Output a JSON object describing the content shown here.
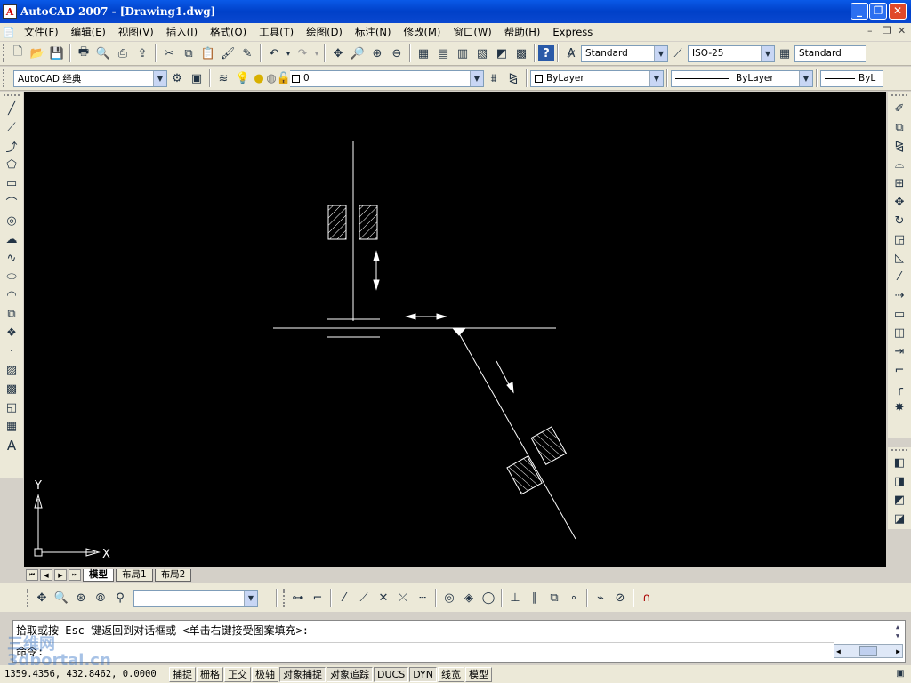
{
  "window": {
    "title": "AutoCAD 2007 - [Drawing1.dwg]",
    "app_icon": "A"
  },
  "menu": [
    "文件(F)",
    "编辑(E)",
    "视图(V)",
    "插入(I)",
    "格式(O)",
    "工具(T)",
    "绘图(D)",
    "标注(N)",
    "修改(M)",
    "窗口(W)",
    "帮助(H)",
    "Express"
  ],
  "styles": {
    "text_style": "Standard",
    "dim_style": "ISO-25",
    "table_style": "Standard"
  },
  "workspace": "AutoCAD 经典",
  "layer": {
    "current": "0"
  },
  "properties": {
    "color": "ByLayer",
    "linetype": "ByLayer",
    "lineweight": "ByL"
  },
  "ucs": {
    "x_label": "X",
    "y_label": "Y"
  },
  "layout_tabs": [
    "模型",
    "布局1",
    "布局2"
  ],
  "command": {
    "history": "拾取或按 Esc 键返回到对话框或 <单击右键接受图案填充>:",
    "prompt": "命令:"
  },
  "status": {
    "coordinates": "1359.4356, 432.8462, 0.0000",
    "toggles": [
      {
        "label": "捕捉",
        "on": false
      },
      {
        "label": "栅格",
        "on": false
      },
      {
        "label": "正交",
        "on": false
      },
      {
        "label": "极轴",
        "on": false
      },
      {
        "label": "对象捕捉",
        "on": true
      },
      {
        "label": "对象追踪",
        "on": true
      },
      {
        "label": "DUCS",
        "on": true
      },
      {
        "label": "DYN",
        "on": true
      },
      {
        "label": "线宽",
        "on": false
      },
      {
        "label": "模型",
        "on": false
      }
    ]
  },
  "watermark": "三维网 3dportal.cn",
  "colors": {
    "canvas": "#000000",
    "titlebar": "#0a5ae8",
    "chrome": "#ece9d8"
  }
}
